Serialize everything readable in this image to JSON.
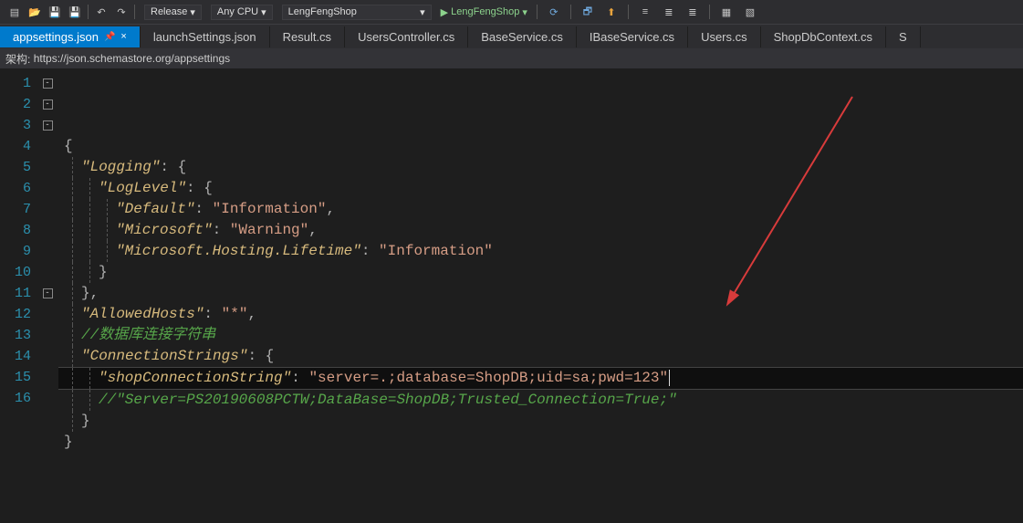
{
  "toolbar": {
    "config": "Release",
    "platform": "Any CPU",
    "project": "LengFengShop",
    "run_label": "LengFengShop"
  },
  "tabs": [
    {
      "label": "appsettings.json",
      "active": true
    },
    {
      "label": "launchSettings.json"
    },
    {
      "label": "Result.cs"
    },
    {
      "label": "UsersController.cs"
    },
    {
      "label": "BaseService.cs"
    },
    {
      "label": "IBaseService.cs"
    },
    {
      "label": "Users.cs"
    },
    {
      "label": "ShopDbContext.cs"
    }
  ],
  "schema": {
    "label": "架构:",
    "url": "https://json.schemastore.org/appsettings"
  },
  "code": {
    "lines": [
      {
        "n": 1,
        "fold": "-",
        "segs": [
          [
            "brace",
            "{"
          ]
        ]
      },
      {
        "n": 2,
        "fold": "-",
        "segs": [
          null,
          [
            "key",
            "\"Logging\""
          ],
          [
            "punc",
            ": "
          ],
          [
            "brace",
            "{"
          ]
        ]
      },
      {
        "n": 3,
        "fold": "-",
        "segs": [
          null,
          null,
          [
            "key",
            "\"LogLevel\""
          ],
          [
            "punc",
            ": "
          ],
          [
            "brace",
            "{"
          ]
        ]
      },
      {
        "n": 4,
        "segs": [
          null,
          null,
          null,
          [
            "key",
            "\"Default\""
          ],
          [
            "punc",
            ": "
          ],
          [
            "str",
            "\"Information\""
          ],
          [
            "punc",
            ","
          ]
        ]
      },
      {
        "n": 5,
        "segs": [
          null,
          null,
          null,
          [
            "key",
            "\"Microsoft\""
          ],
          [
            "punc",
            ": "
          ],
          [
            "str",
            "\"Warning\""
          ],
          [
            "punc",
            ","
          ]
        ]
      },
      {
        "n": 6,
        "segs": [
          null,
          null,
          null,
          [
            "key",
            "\"Microsoft.Hosting.Lifetime\""
          ],
          [
            "punc",
            ": "
          ],
          [
            "str",
            "\"Information\""
          ]
        ]
      },
      {
        "n": 7,
        "segs": [
          null,
          null,
          [
            "brace",
            "}"
          ]
        ]
      },
      {
        "n": 8,
        "segs": [
          null,
          [
            "brace",
            "}"
          ],
          [
            "punc",
            ","
          ]
        ]
      },
      {
        "n": 9,
        "segs": [
          null,
          [
            "key",
            "\"AllowedHosts\""
          ],
          [
            "punc",
            ": "
          ],
          [
            "str",
            "\"*\""
          ],
          [
            "punc",
            ","
          ]
        ]
      },
      {
        "n": 10,
        "segs": [
          null,
          [
            "cmt",
            "//数据库连接字符串"
          ]
        ]
      },
      {
        "n": 11,
        "fold": "-",
        "segs": [
          null,
          [
            "key",
            "\"ConnectionStrings\""
          ],
          [
            "punc",
            ": "
          ],
          [
            "brace",
            "{"
          ]
        ]
      },
      {
        "n": 12,
        "hl": true,
        "change": true,
        "segs": [
          null,
          null,
          [
            "key",
            "\"shopConnectionString\""
          ],
          [
            "punc",
            ": "
          ],
          [
            "str",
            "\"server=.;database=ShopDB;uid=sa;pwd=123\""
          ]
        ],
        "cursor": true
      },
      {
        "n": 13,
        "change": true,
        "segs": [
          null,
          null,
          [
            "cmt",
            "//\"Server=PS20190608PCTW;DataBase=ShopDB;Trusted_Connection=True;\""
          ]
        ]
      },
      {
        "n": 14,
        "segs": [
          null,
          [
            "brace",
            "}"
          ]
        ]
      },
      {
        "n": 15,
        "segs": [
          [
            "brace",
            "}"
          ]
        ]
      },
      {
        "n": 16,
        "segs": []
      }
    ]
  }
}
